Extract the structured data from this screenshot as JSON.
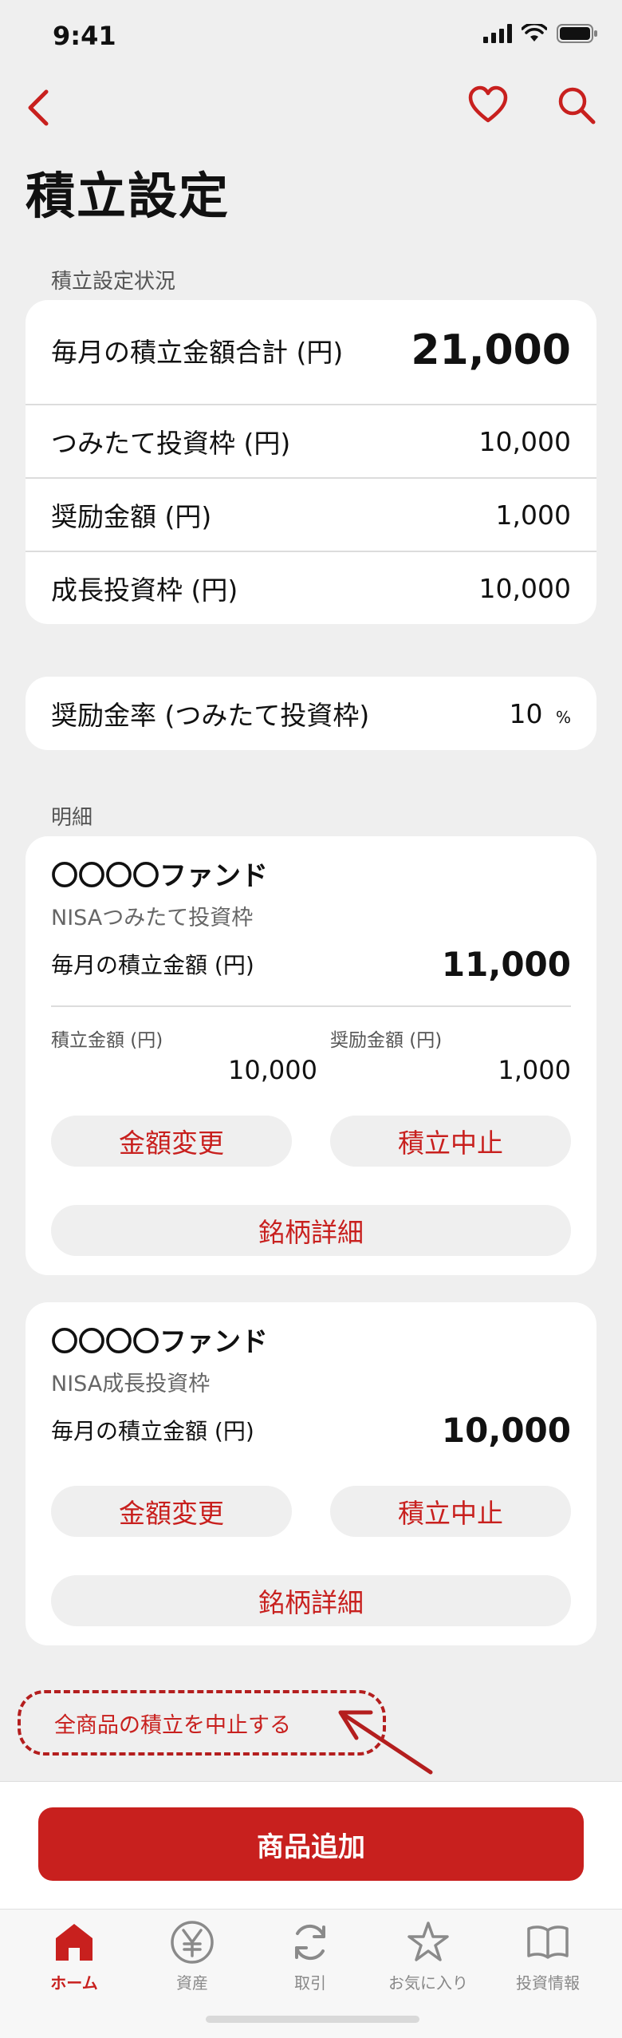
{
  "status": {
    "time": "9:41"
  },
  "page": {
    "title": "積立設定"
  },
  "summary": {
    "section_label": "積立設定状況",
    "total_label": "毎月の積立金額合計 (円)",
    "total_value": "21,000",
    "rows": [
      {
        "label": "つみたて投資枠 (円)",
        "value": "10,000"
      },
      {
        "label": "奨励金額 (円)",
        "value": "1,000"
      },
      {
        "label": "成長投資枠 (円)",
        "value": "10,000"
      }
    ]
  },
  "rate": {
    "label": "奨励金率 (つみたて投資枠)",
    "value": "10",
    "unit": "%"
  },
  "details": {
    "section_label": "明細",
    "funds": [
      {
        "name": "〇〇〇〇ファンド",
        "type": "NISAつみたて投資枠",
        "monthly_label": "毎月の積立金額 (円)",
        "monthly_value": "11,000",
        "sub_label_1": "積立金額 (円)",
        "sub_value_1": "10,000",
        "sub_label_2": "奨励金額 (円)",
        "sub_value_2": "1,000",
        "change_label": "金額変更",
        "stop_label": "積立中止",
        "detail_label": "銘柄詳細"
      },
      {
        "name": "〇〇〇〇ファンド",
        "type": "NISA成長投資枠",
        "monthly_label": "毎月の積立金額 (円)",
        "monthly_value": "10,000",
        "change_label": "金額変更",
        "stop_label": "積立中止",
        "detail_label": "銘柄詳細"
      }
    ]
  },
  "stop_all_label": "全商品の積立を中止する",
  "add_button_label": "商品追加",
  "tabs": [
    {
      "label": "ホーム",
      "icon": "home-icon",
      "active": true
    },
    {
      "label": "資産",
      "icon": "yen-icon"
    },
    {
      "label": "取引",
      "icon": "refresh-icon"
    },
    {
      "label": "お気に入り",
      "icon": "star-icon"
    },
    {
      "label": "投資情報",
      "icon": "book-icon"
    }
  ],
  "colors": {
    "accent": "#c8201e",
    "background": "#efefef",
    "card": "#ffffff"
  }
}
